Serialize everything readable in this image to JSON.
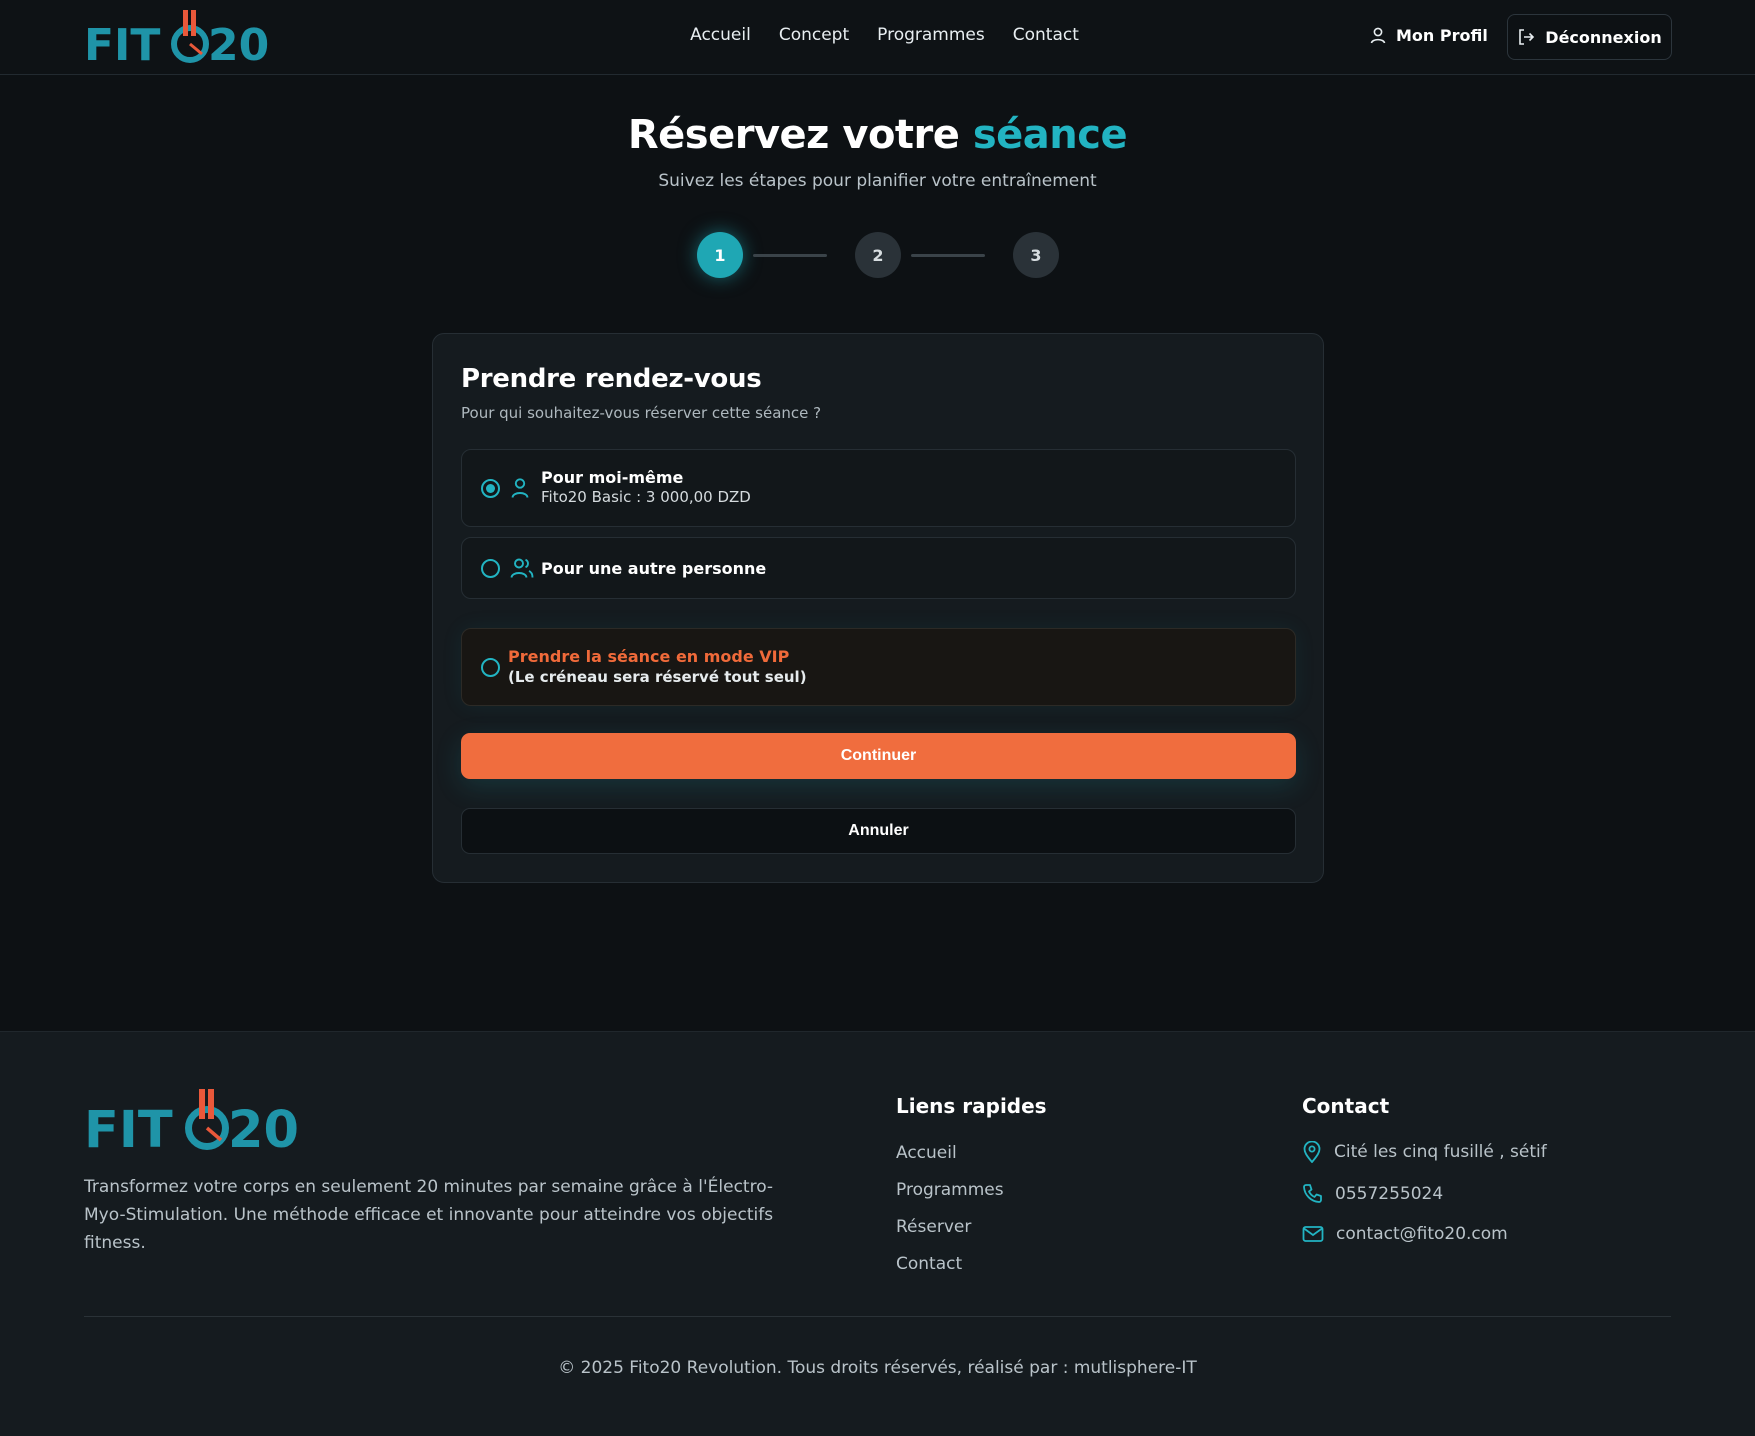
{
  "brand": {
    "logo_left": "FIT",
    "logo_right": "20",
    "teal": "#1fa7b4",
    "orange": "#f06d3e"
  },
  "nav": {
    "items": [
      "Accueil",
      "Concept",
      "Programmes",
      "Contact"
    ],
    "profile": "Mon Profil",
    "logout": "Déconnexion"
  },
  "hero": {
    "title_main": "Réservez votre",
    "title_accent": "séance",
    "subtitle": "Suivez les étapes pour planifier votre entraînement"
  },
  "stepper": {
    "steps": [
      "1",
      "2",
      "3"
    ],
    "current": 1
  },
  "card": {
    "title": "Prendre rendez-vous",
    "subtitle": "Pour qui souhaitez-vous réserver cette séance ?",
    "options": [
      {
        "title": "Pour moi-même",
        "subtitle": "Fito20 Basic : 3 000,00 DZD",
        "checked": true,
        "icon": "user-icon"
      },
      {
        "title": "Pour une autre personne",
        "checked": false,
        "icon": "users-icon"
      }
    ],
    "vip": {
      "title": "Prendre la séance en mode VIP",
      "subtitle": "(Le créneau sera réservé tout seul)",
      "checked": false
    },
    "continue_label": "Continuer",
    "cancel_label": "Annuler"
  },
  "footer": {
    "description": "Transformez votre corps en seulement 20 minutes par semaine grâce à l'Électro-Myo-Stimulation. Une méthode efficace et innovante pour atteindre vos objectifs fitness.",
    "quick_links_heading": "Liens rapides",
    "quick_links": [
      "Accueil",
      "Programmes",
      "Réserver",
      "Contact"
    ],
    "contact_heading": "Contact",
    "address": "Cité les cinq fusillé , sétif",
    "phone": "0557255024",
    "email": "contact@fito20.com",
    "copyright": "© 2025 Fito20 Revolution. Tous droits réservés, réalisé par : mutlisphere-IT"
  }
}
